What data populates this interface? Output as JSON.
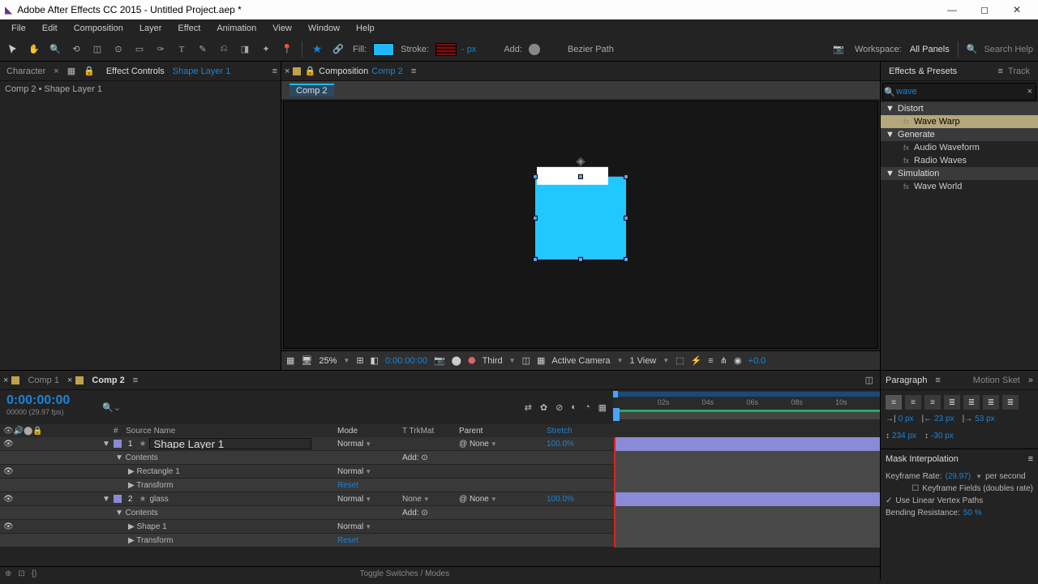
{
  "title": "Adobe After Effects CC 2015 - Untitled Project.aep *",
  "menu": [
    "File",
    "Edit",
    "Composition",
    "Layer",
    "Effect",
    "Animation",
    "View",
    "Window",
    "Help"
  ],
  "toolbar": {
    "fill_label": "Fill:",
    "stroke_label": "Stroke:",
    "stroke_px": "- px",
    "add_label": "Add:",
    "bezier": "Bezier Path",
    "workspace_label": "Workspace:",
    "workspace_value": "All Panels",
    "search_placeholder": "Search Help"
  },
  "effect_controls": {
    "tab_character": "Character",
    "tab_effect": "Effect Controls",
    "layer_link": "Shape Layer 1",
    "crumb": "Comp 2 • Shape Layer 1"
  },
  "comp_panel": {
    "tab_label": "Composition",
    "comp_link": "Comp 2",
    "sub_tab": "Comp 2"
  },
  "comp_footer": {
    "zoom": "25%",
    "timecode": "0:00:00:00",
    "quality": "Third",
    "camera": "Active Camera",
    "views": "1 View",
    "exposure": "+0.0"
  },
  "effects_presets": {
    "tab": "Effects & Presets",
    "tab2": "Track",
    "search": "wave",
    "cats": [
      {
        "name": "Distort",
        "items": [
          {
            "name": "Wave Warp",
            "sel": true
          }
        ]
      },
      {
        "name": "Generate",
        "items": [
          {
            "name": "Audio Waveform"
          },
          {
            "name": "Radio Waves"
          }
        ]
      },
      {
        "name": "Simulation",
        "items": [
          {
            "name": "Wave World"
          }
        ]
      }
    ]
  },
  "timeline": {
    "tab1": "Comp 1",
    "tab2": "Comp 2",
    "timecode": "0:00:00:00",
    "fps": "00000 (29.97 fps)",
    "ruler": [
      "",
      "02s",
      "04s",
      "06s",
      "08s",
      "10s"
    ],
    "cols": {
      "c2": "Source Name",
      "c3": "Mode",
      "c4": "T   TrkMat",
      "c5": "Parent",
      "c6": "Stretch"
    },
    "rows": [
      {
        "eye": true,
        "idx": "1",
        "name": "Shape Layer 1",
        "mode": "Normal",
        "trk": "",
        "parent": "None",
        "stretch": "100.0%",
        "edit": true,
        "layer": true
      },
      {
        "indent": 1,
        "name": "Contents",
        "add": "Add:"
      },
      {
        "eye": true,
        "indent": 2,
        "name": "Rectangle 1",
        "mode": "Normal"
      },
      {
        "indent": 2,
        "name": "Transform",
        "reset": "Reset"
      },
      {
        "eye": true,
        "idx": "2",
        "name": "glass",
        "mode": "Normal",
        "trk": "None",
        "parent": "None",
        "stretch": "100.0%",
        "layer": true
      },
      {
        "indent": 1,
        "name": "Contents",
        "add": "Add:"
      },
      {
        "eye": true,
        "indent": 2,
        "name": "Shape 1",
        "mode": "Normal"
      },
      {
        "indent": 2,
        "name": "Transform",
        "reset": "Reset"
      }
    ],
    "toggle": "Toggle Switches / Modes"
  },
  "paragraph": {
    "tab": "Paragraph",
    "tab2": "Motion Sket",
    "spacing": [
      {
        "icon": "→|",
        "v": "0 px"
      },
      {
        "icon": "|←",
        "v": "23 px"
      },
      {
        "icon": "|→",
        "v": "53 px"
      },
      {
        "icon": "↕",
        "v": "234 px"
      },
      {
        "icon": "↕",
        "v": "-30 px"
      }
    ]
  },
  "mask": {
    "title": "Mask Interpolation",
    "rate_label": "Keyframe Rate:",
    "rate": "(29.97)",
    "rate_unit": "per second",
    "fields": "Keyframe Fields (doubles rate)",
    "linear": "Use Linear Vertex Paths",
    "bend_label": "Bending Resistance:",
    "bend": "50 %"
  }
}
